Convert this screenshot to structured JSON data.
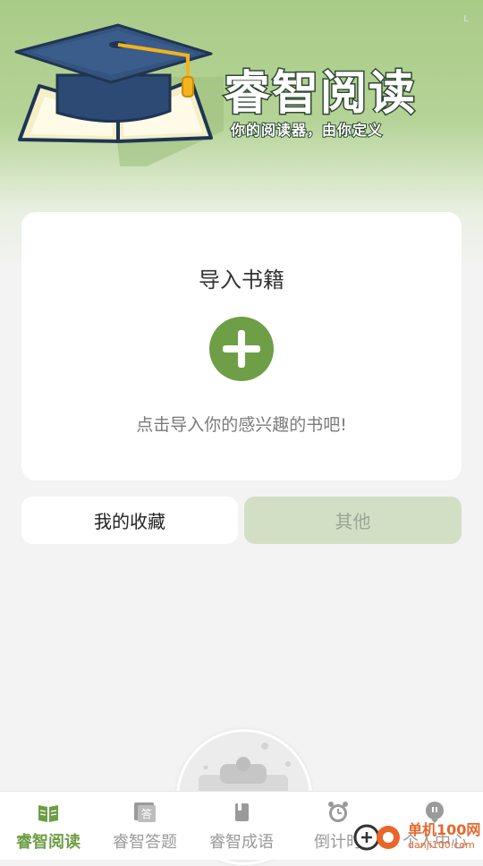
{
  "header": {
    "app_title": "睿智阅读",
    "slogan": "你的阅读器，由你定义",
    "corner_mark": "L",
    "logo_icon": "graduation-cap-book-icon"
  },
  "import_card": {
    "title": "导入书籍",
    "add_icon": "plus-circle-icon",
    "hint": "点击导入你的感兴趣的书吧!"
  },
  "tabs": [
    {
      "label": "我的收藏",
      "selected": true
    },
    {
      "label": "其他",
      "selected": false
    }
  ],
  "bottom_nav": [
    {
      "label": "睿智阅读",
      "icon": "book-open-icon",
      "active": true
    },
    {
      "label": "睿智答题",
      "icon": "answer-card-icon",
      "active": false
    },
    {
      "label": "睿智成语",
      "icon": "book-icon",
      "active": false
    },
    {
      "label": "倒计时",
      "icon": "alarm-clock-icon",
      "active": false
    },
    {
      "label": "个人中心",
      "icon": "person-icon",
      "active": false
    }
  ],
  "watermark": {
    "text": "单机100网",
    "url": "danji100.com"
  },
  "colors": {
    "accent": "#6e9e46",
    "header_green": "#a9cb88",
    "tab_inactive": "#d3dfc5"
  }
}
